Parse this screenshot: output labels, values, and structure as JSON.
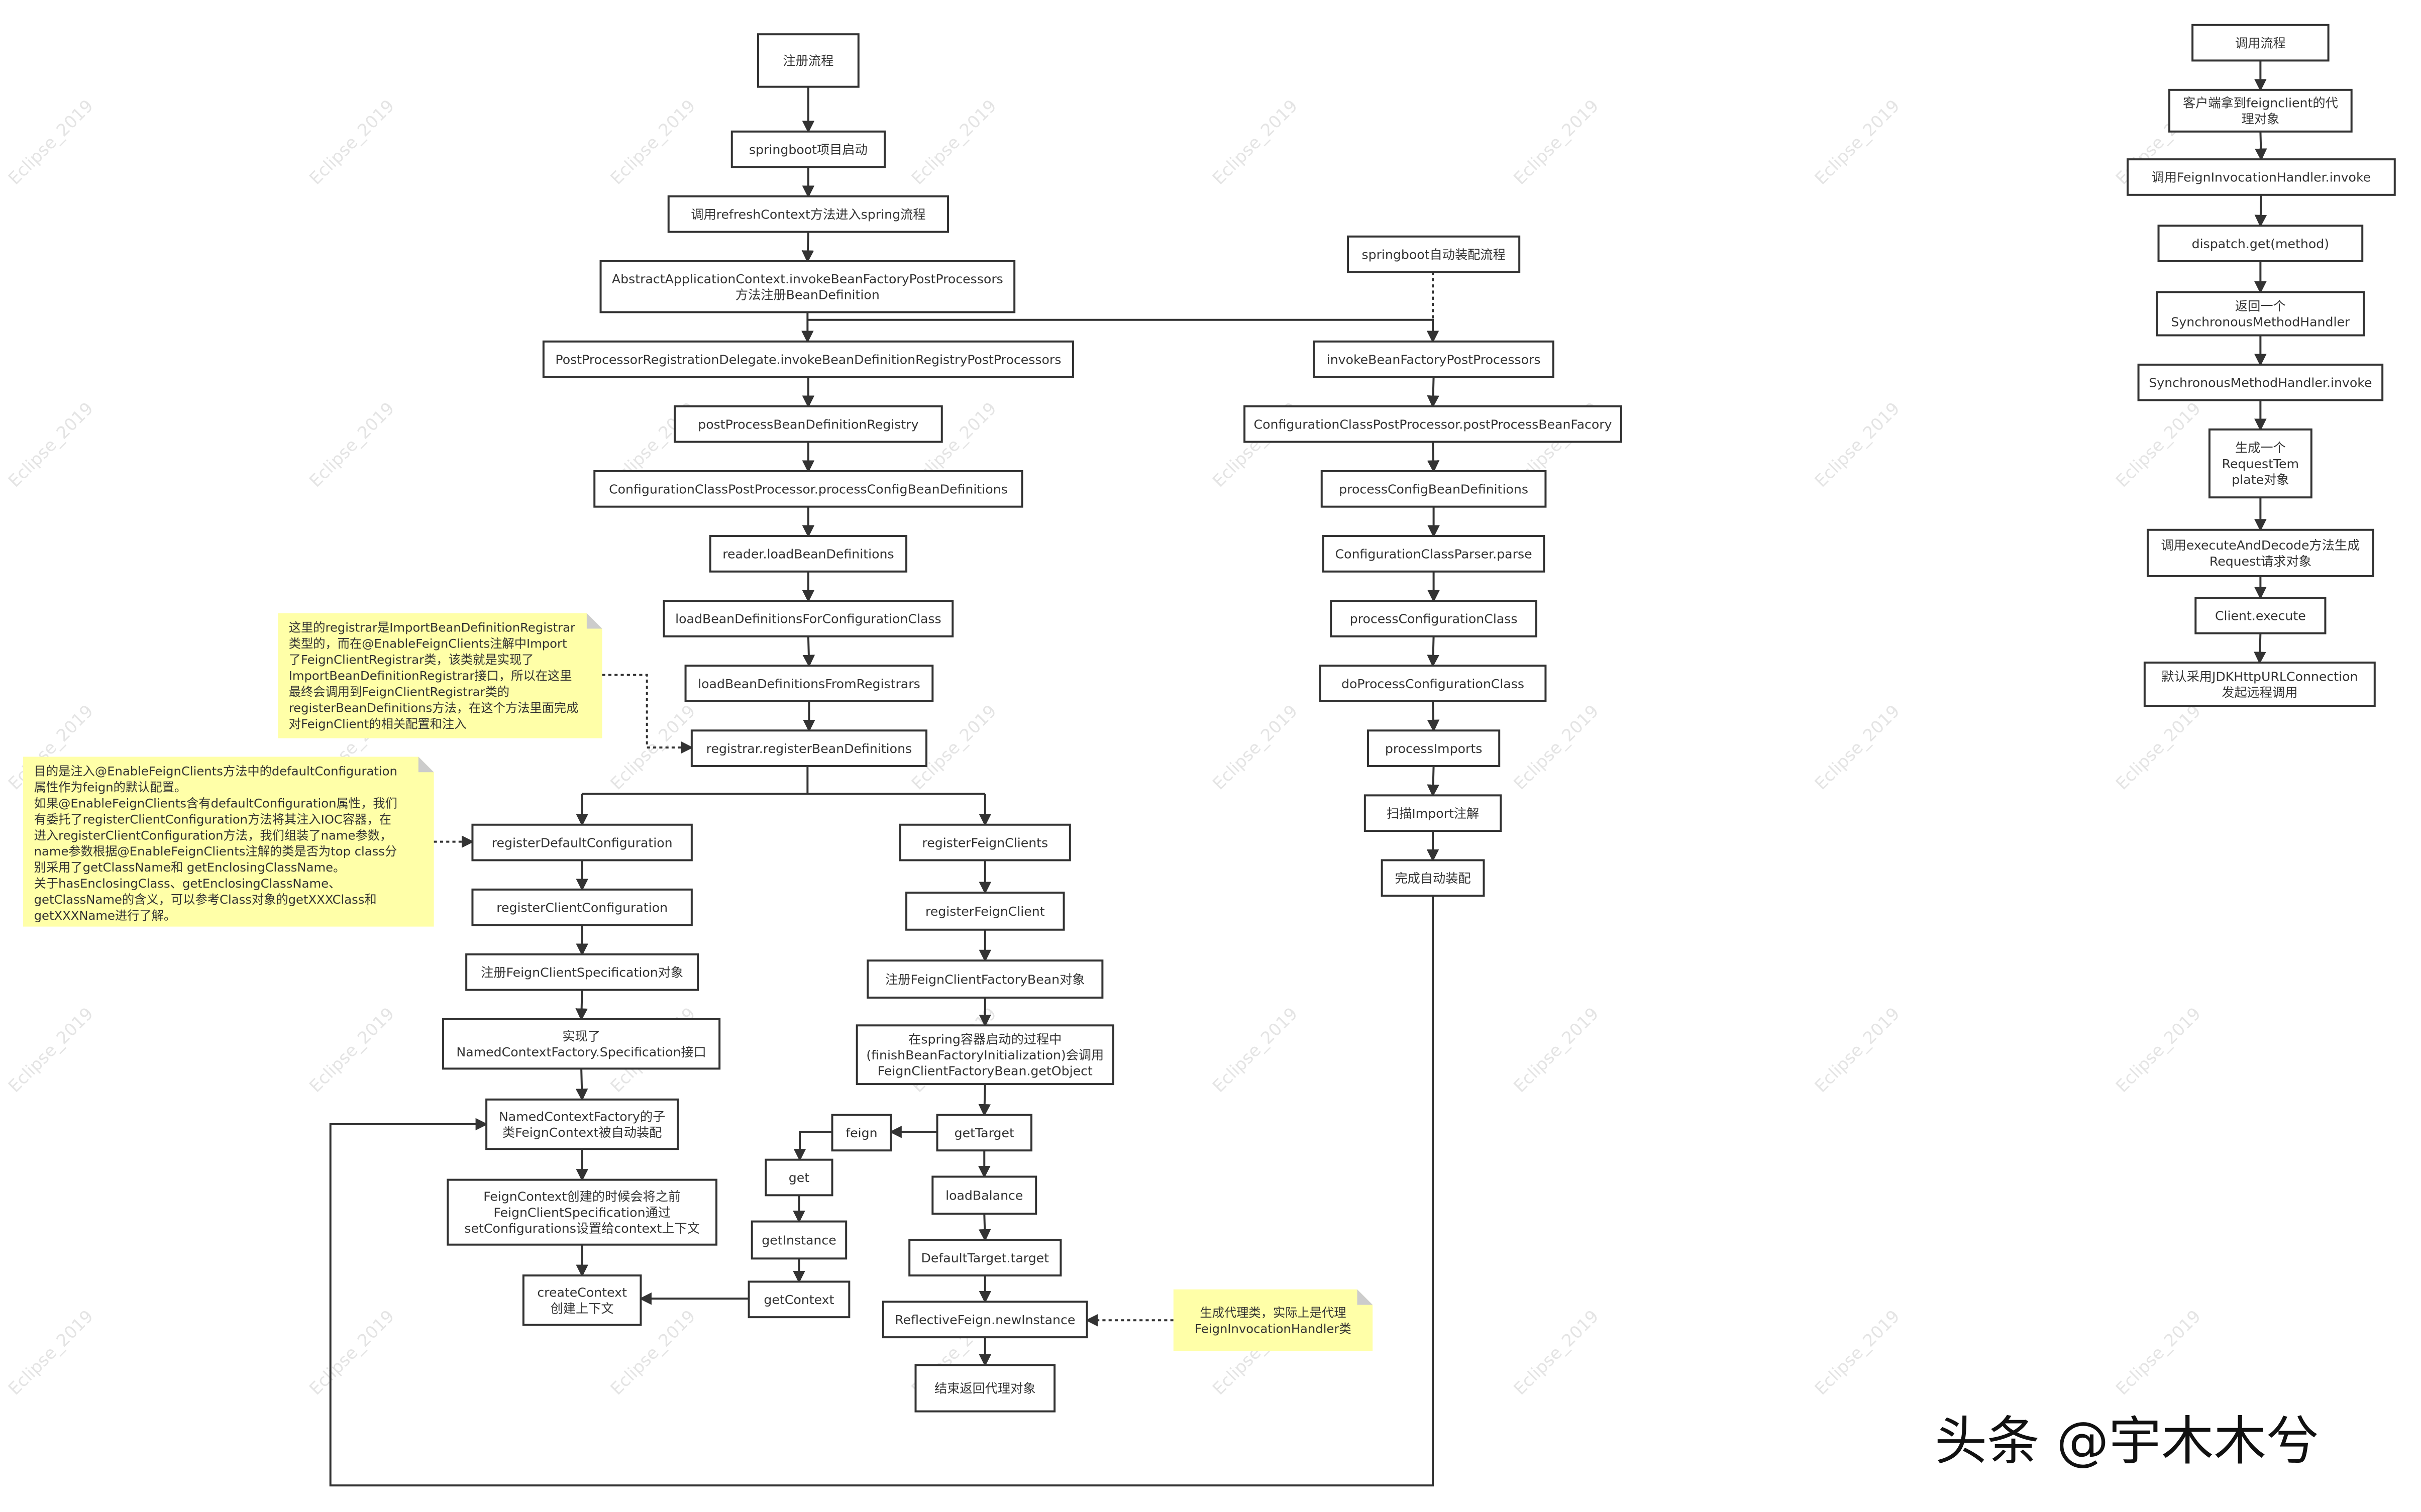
{
  "diagram": {
    "watermark": "Eclipse_2019",
    "brand": "头条 @宇木木兮",
    "nodes": {
      "n1": [
        "注册流程"
      ],
      "n2": [
        "springboot项目启动"
      ],
      "n3": [
        "调用refreshContext方法进入spring流程"
      ],
      "n4": [
        "AbstractApplicationContext.invokeBeanFactoryPostProcessors",
        "方法注册BeanDefinition"
      ],
      "n5": [
        "PostProcessorRegistrationDelegate.invokeBeanDefinitionRegistryPostProcessors"
      ],
      "n6": [
        "postProcessBeanDefinitionRegistry"
      ],
      "n7": [
        "ConfigurationClassPostProcessor.processConfigBeanDefinitions"
      ],
      "n8": [
        "reader.loadBeanDefinitions"
      ],
      "n9": [
        "loadBeanDefinitionsForConfigurationClass"
      ],
      "n10": [
        "loadBeanDefinitionsFromRegistrars"
      ],
      "n11": [
        "registrar.registerBeanDefinitions"
      ],
      "n12": [
        "registerDefaultConfiguration"
      ],
      "n13": [
        "registerClientConfiguration"
      ],
      "n14": [
        "注册FeignClientSpecification对象"
      ],
      "n15": [
        "实现了",
        "NamedContextFactory.Specification接口"
      ],
      "n16": [
        "NamedContextFactory的子",
        "类FeignContext被自动装配"
      ],
      "n17": [
        "FeignContext创建的时候会将之前",
        "FeignClientSpecification通过",
        "setConfigurations设置给context上下文"
      ],
      "n18": [
        "createContext",
        "创建上下文"
      ],
      "n19": [
        "registerFeignClients"
      ],
      "n20": [
        "registerFeignClient"
      ],
      "n21": [
        "注册FeignClientFactoryBean对象"
      ],
      "n22": [
        "在spring容器启动的过程中",
        "(finishBeanFactoryInitialization)会调用",
        "FeignClientFactoryBean.getObject"
      ],
      "n23": [
        "getTarget"
      ],
      "n24": [
        "feign"
      ],
      "n25": [
        "get"
      ],
      "n26": [
        "getInstance"
      ],
      "n27": [
        "getContext"
      ],
      "n28": [
        "loadBalance"
      ],
      "n29": [
        "DefaultTarget.target"
      ],
      "n30": [
        "ReflectiveFeign.newInstance"
      ],
      "n31": [
        "结束返回代理对象"
      ],
      "n32": [
        "springboot自动装配流程"
      ],
      "n33": [
        "invokeBeanFactoryPostProcessors"
      ],
      "n34": [
        "ConfigurationClassPostProcessor.postProcessBeanFacory"
      ],
      "n35": [
        "processConfigBeanDefinitions"
      ],
      "n36": [
        "ConfigurationClassParser.parse"
      ],
      "n37": [
        "processConfigurationClass"
      ],
      "n38": [
        "doProcessConfigurationClass"
      ],
      "n39": [
        "processImports"
      ],
      "n40": [
        "扫描Import注解"
      ],
      "n41": [
        "完成自动装配"
      ],
      "r1": [
        "调用流程"
      ],
      "r2": [
        "客户端拿到feignclient的代",
        "理对象"
      ],
      "r3": [
        "调用FeignInvocationHandler.invoke"
      ],
      "r4": [
        "dispatch.get(method)"
      ],
      "r5": [
        "返回一个",
        "SynchronousMethodHandler"
      ],
      "r6": [
        "SynchronousMethodHandler.invoke"
      ],
      "r7": [
        "生成一个",
        "RequestTem",
        "plate对象"
      ],
      "r8": [
        "调用executeAndDecode方法生成",
        "Request请求对象"
      ],
      "r9": [
        "Client.execute"
      ],
      "r10": [
        "默认采用JDKHttpURLConnection",
        "发起远程调用"
      ]
    },
    "notes": {
      "note1": [
        "这里的registrar是ImportBeanDefinitionRegistrar",
        "类型的，而在@EnableFeignClients注解中Import",
        "了FeignClientRegistrar类，该类就是实现了",
        "ImportBeanDefinitionRegistrar接口，所以在这里",
        "最终会调用到FeignClientRegistrar类的",
        "registerBeanDefinitions方法，在这个方法里面完成",
        "对FeignClient的相关配置和注入"
      ],
      "note2": [
        "目的是注入@EnableFeignClients方法中的defaultConfiguration",
        "属性作为feign的默认配置。",
        "如果@EnableFeignClients含有defaultConfiguration属性，我们",
        "有委托了registerClientConfiguration方法将其注入IOC容器，在",
        "进入registerClientConfiguration方法，我们组装了name参数，",
        "name参数根据@EnableFeignClients注解的类是否为top class分",
        "别采用了getClassName和 getEnclosingClassName。",
        "关于hasEnclosingClass、getEnclosingClassName、",
        "getClassName的含义，可以参考Class对象的getXXXClass和",
        "getXXXName进行了解。"
      ],
      "note3": [
        "生成代理类，实际上是代理",
        "FeignInvocationHandler类"
      ]
    },
    "colors": {
      "note": "#ffffa8",
      "stroke": "#333333"
    }
  }
}
